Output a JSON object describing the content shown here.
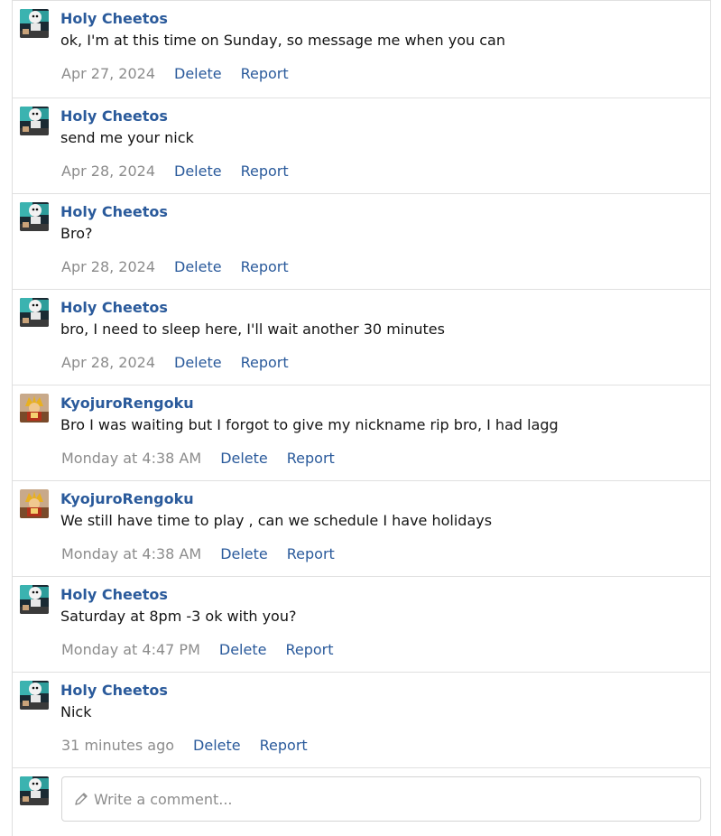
{
  "actions": {
    "delete": "Delete",
    "report": "Report"
  },
  "comments": [
    {
      "user": "Holy Cheetos",
      "avatar": "cheetos",
      "text": "ok, I'm at this time on Sunday, so message me when you can",
      "time": "Apr 27, 2024"
    },
    {
      "user": "Holy Cheetos",
      "avatar": "cheetos",
      "text": "send me your nick",
      "time": "Apr 28, 2024"
    },
    {
      "user": "Holy Cheetos",
      "avatar": "cheetos",
      "text": "Bro?",
      "time": "Apr 28, 2024"
    },
    {
      "user": "Holy Cheetos",
      "avatar": "cheetos",
      "text": "bro, I need to sleep here, I'll wait another 30 minutes",
      "time": "Apr 28, 2024"
    },
    {
      "user": "KyojuroRengoku",
      "avatar": "rengoku",
      "text": "Bro I was waiting but I forgot to give my nickname rip bro, I had lagg",
      "time": "Monday at 4:38 AM"
    },
    {
      "user": "KyojuroRengoku",
      "avatar": "rengoku",
      "text": "We still have time to play , can we schedule I have holidays",
      "time": "Monday at 4:38 AM"
    },
    {
      "user": "Holy Cheetos",
      "avatar": "cheetos",
      "text": "Saturday at 8pm -3 ok with you?",
      "time": "Monday at 4:47 PM"
    },
    {
      "user": "Holy Cheetos",
      "avatar": "cheetos",
      "text": "Nick",
      "time": "31 minutes ago"
    }
  ],
  "composer": {
    "placeholder": "Write a comment..."
  },
  "colors": {
    "link": "#2a5a9b",
    "muted": "#8c8c8c",
    "border": "#e0e0e0"
  },
  "icons": {
    "composer": "pencil-icon"
  }
}
